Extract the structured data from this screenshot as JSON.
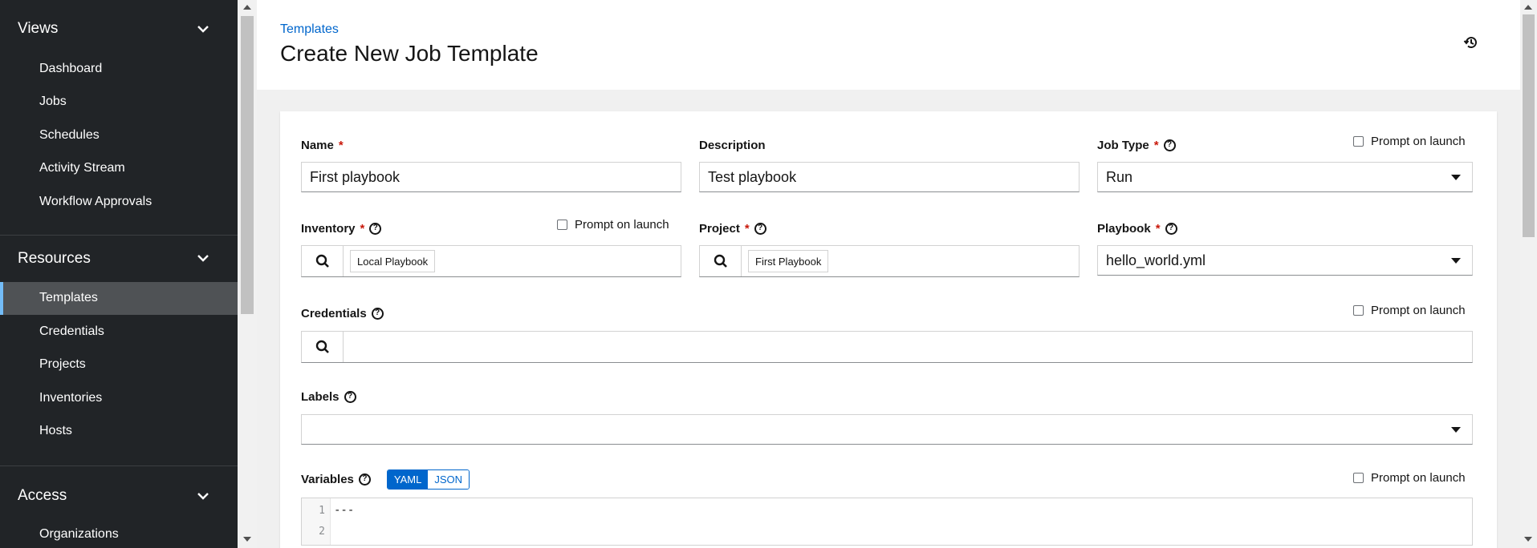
{
  "sidebar": {
    "groups": [
      {
        "label": "Views",
        "items": [
          {
            "label": "Dashboard"
          },
          {
            "label": "Jobs"
          },
          {
            "label": "Schedules"
          },
          {
            "label": "Activity Stream"
          },
          {
            "label": "Workflow Approvals"
          }
        ]
      },
      {
        "label": "Resources",
        "items": [
          {
            "label": "Templates",
            "active": true
          },
          {
            "label": "Credentials"
          },
          {
            "label": "Projects"
          },
          {
            "label": "Inventories"
          },
          {
            "label": "Hosts"
          }
        ]
      },
      {
        "label": "Access",
        "items": [
          {
            "label": "Organizations"
          }
        ]
      }
    ]
  },
  "header": {
    "breadcrumb": "Templates",
    "title": "Create New Job Template",
    "history_icon": "history-icon"
  },
  "form": {
    "prompt_label": "Prompt on launch",
    "name": {
      "label": "Name",
      "value": "First playbook"
    },
    "description": {
      "label": "Description",
      "value": "Test playbook"
    },
    "job_type": {
      "label": "Job Type",
      "value": "Run"
    },
    "inventory": {
      "label": "Inventory",
      "chip": "Local Playbook"
    },
    "project": {
      "label": "Project",
      "chip": "First Playbook"
    },
    "playbook": {
      "label": "Playbook",
      "value": "hello_world.yml"
    },
    "credentials": {
      "label": "Credentials"
    },
    "labels": {
      "label": "Labels"
    },
    "variables": {
      "label": "Variables",
      "modes": [
        "YAML",
        "JSON"
      ],
      "active_mode": "YAML",
      "lines": [
        {
          "no": "1",
          "text": "---"
        },
        {
          "no": "2",
          "text": ""
        }
      ]
    }
  },
  "colors": {
    "sidebar_bg": "#212427",
    "accent": "#0066cc",
    "active_indicator": "#73bcf7",
    "required": "#c9190b"
  }
}
